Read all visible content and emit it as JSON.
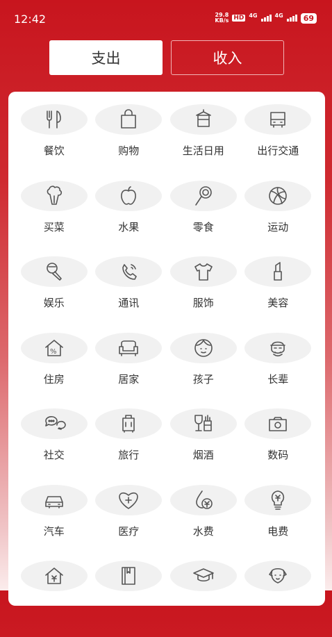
{
  "status": {
    "time": "12:42",
    "net_speed_top": "29.8",
    "net_speed_bottom": "KB/s",
    "hd": "HD",
    "lte1": "4G",
    "lte2": "4G",
    "battery": "69"
  },
  "tabs": {
    "expense": "支出",
    "income": "收入"
  },
  "categories": [
    {
      "label": "餐饮",
      "icon": "utensils-icon"
    },
    {
      "label": "购物",
      "icon": "shopping-bag-icon"
    },
    {
      "label": "生活日用",
      "icon": "towel-hanger-icon"
    },
    {
      "label": "出行交通",
      "icon": "bus-icon"
    },
    {
      "label": "买菜",
      "icon": "vegetable-icon"
    },
    {
      "label": "水果",
      "icon": "apple-icon"
    },
    {
      "label": "零食",
      "icon": "lollipop-icon"
    },
    {
      "label": "运动",
      "icon": "ball-icon"
    },
    {
      "label": "娱乐",
      "icon": "microphone-icon"
    },
    {
      "label": "通讯",
      "icon": "phone-icon"
    },
    {
      "label": "服饰",
      "icon": "tshirt-icon"
    },
    {
      "label": "美容",
      "icon": "lipstick-icon"
    },
    {
      "label": "住房",
      "icon": "house-percent-icon"
    },
    {
      "label": "居家",
      "icon": "sofa-icon"
    },
    {
      "label": "孩子",
      "icon": "child-face-icon"
    },
    {
      "label": "长辈",
      "icon": "elder-face-icon"
    },
    {
      "label": "社交",
      "icon": "chat-bubbles-icon"
    },
    {
      "label": "旅行",
      "icon": "suitcase-icon"
    },
    {
      "label": "烟酒",
      "icon": "wine-cigarette-icon"
    },
    {
      "label": "数码",
      "icon": "camera-icon"
    },
    {
      "label": "汽车",
      "icon": "car-icon"
    },
    {
      "label": "医疗",
      "icon": "heart-plus-icon"
    },
    {
      "label": "水费",
      "icon": "water-drop-yen-icon"
    },
    {
      "label": "电费",
      "icon": "bulb-yen-icon"
    },
    {
      "label": "",
      "icon": "house-yen-icon"
    },
    {
      "label": "",
      "icon": "book-icon"
    },
    {
      "label": "",
      "icon": "graduation-cap-icon"
    },
    {
      "label": "",
      "icon": "dog-icon"
    }
  ]
}
